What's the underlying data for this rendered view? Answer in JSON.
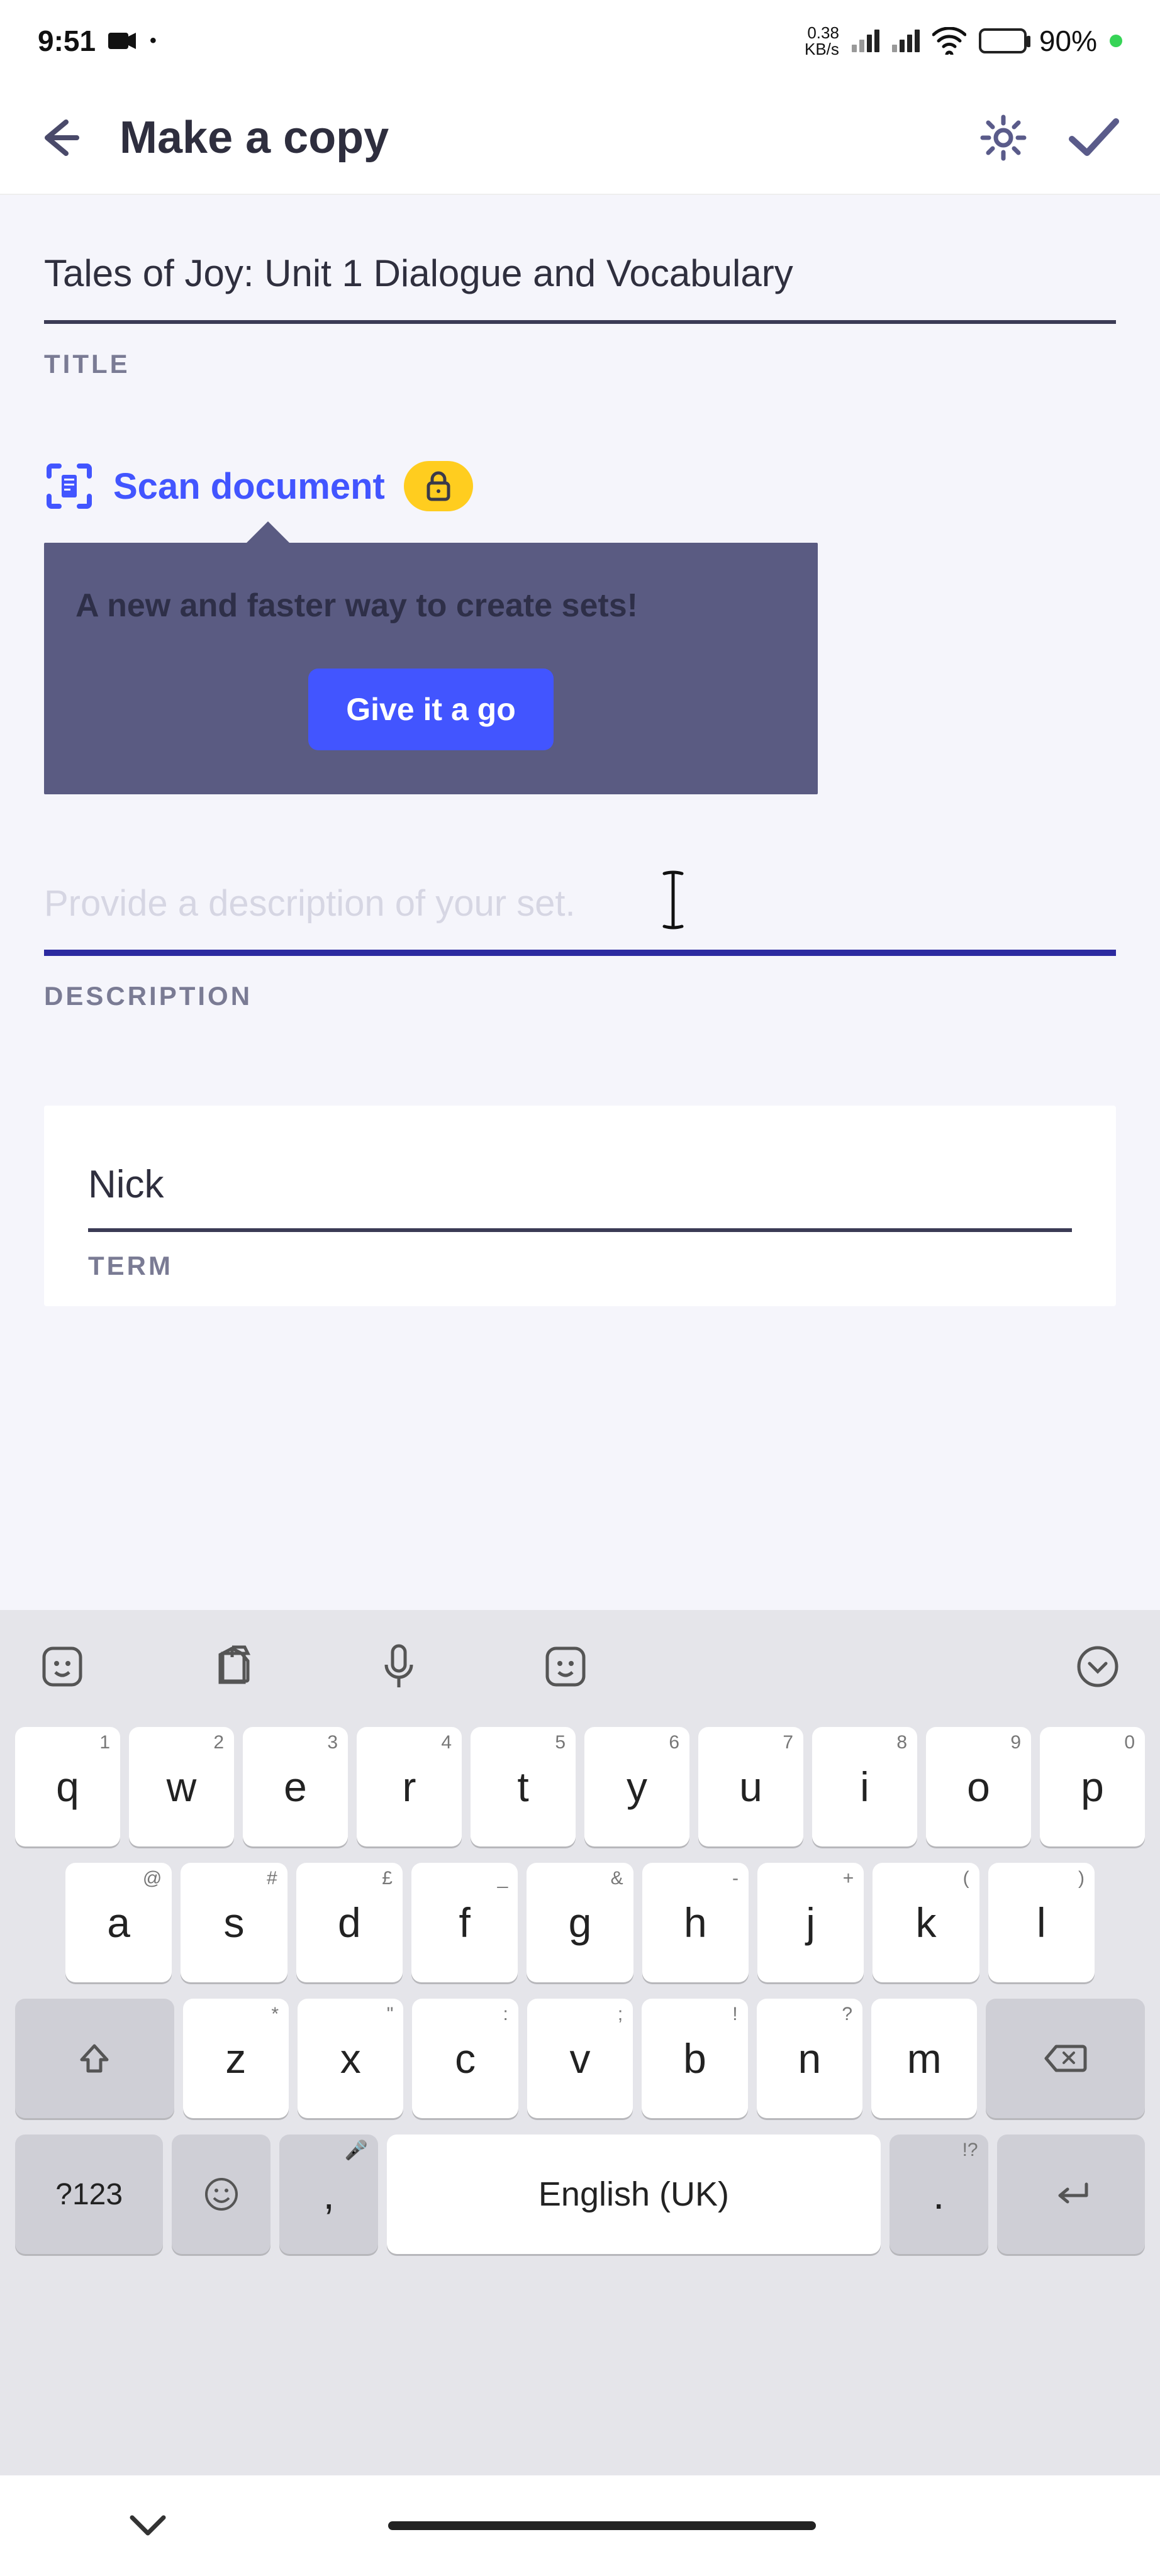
{
  "status": {
    "time": "9:51",
    "speed_top": "0.38",
    "speed_bottom": "KB/s",
    "battery_pct": "90%"
  },
  "header": {
    "title": "Make a copy"
  },
  "form": {
    "title_value": "Tales of Joy: Unit 1 Dialogue and Vocabulary",
    "title_label": "TITLE",
    "scan_label": "Scan document",
    "tooltip_text": "A new and faster way to create sets!",
    "tooltip_cta": "Give it a go",
    "description_placeholder": "Provide a description of your set.",
    "description_label": "DESCRIPTION",
    "term_value": "Nick",
    "term_label": "TERM"
  },
  "keyboard": {
    "row1": [
      {
        "main": "q",
        "sup": "1"
      },
      {
        "main": "w",
        "sup": "2"
      },
      {
        "main": "e",
        "sup": "3"
      },
      {
        "main": "r",
        "sup": "4"
      },
      {
        "main": "t",
        "sup": "5"
      },
      {
        "main": "y",
        "sup": "6"
      },
      {
        "main": "u",
        "sup": "7"
      },
      {
        "main": "i",
        "sup": "8"
      },
      {
        "main": "o",
        "sup": "9"
      },
      {
        "main": "p",
        "sup": "0"
      }
    ],
    "row2": [
      {
        "main": "a",
        "sup": "@"
      },
      {
        "main": "s",
        "sup": "#"
      },
      {
        "main": "d",
        "sup": "£"
      },
      {
        "main": "f",
        "sup": "_"
      },
      {
        "main": "g",
        "sup": "&"
      },
      {
        "main": "h",
        "sup": "-"
      },
      {
        "main": "j",
        "sup": "+"
      },
      {
        "main": "k",
        "sup": "("
      },
      {
        "main": "l",
        "sup": ")"
      }
    ],
    "row3": [
      {
        "main": "z",
        "sup": "*"
      },
      {
        "main": "x",
        "sup": "\""
      },
      {
        "main": "c",
        "sup": ":"
      },
      {
        "main": "v",
        "sup": ";"
      },
      {
        "main": "b",
        "sup": "!"
      },
      {
        "main": "n",
        "sup": "?"
      },
      {
        "main": "m",
        "sup": ""
      }
    ],
    "symkey": "?123",
    "comma": ",",
    "space": "English (UK)",
    "period": ".",
    "period_sup": "!?"
  }
}
